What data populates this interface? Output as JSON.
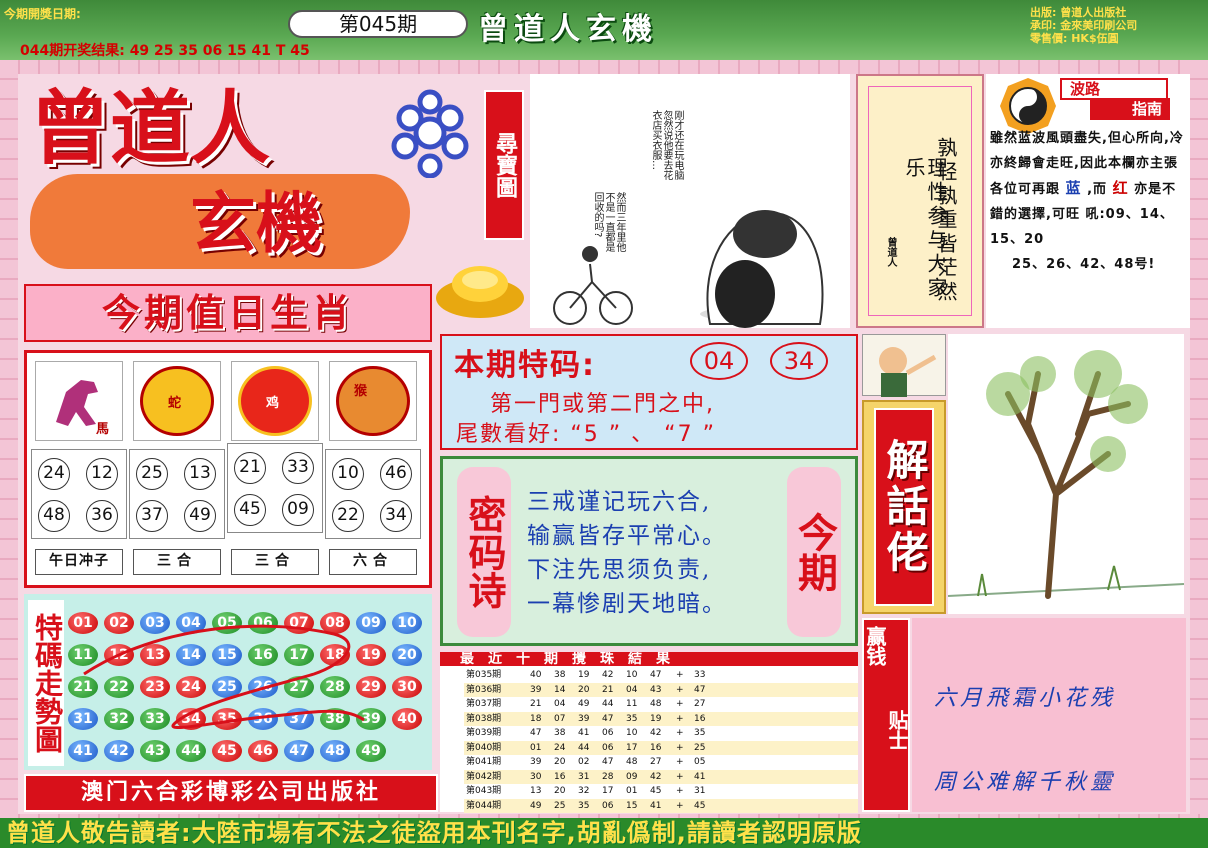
{
  "header": {
    "pub_date_label": "今期開獎日期:",
    "issue": "第045期",
    "prev_result": "044期开奖结果: 49 25 35 06 15 41 T 45",
    "brand": "曾道人玄機",
    "publisher_info": [
      "出版: 曾道人出版社",
      "承印: 金來美印刷公司",
      "零售價: HK$伍圓"
    ]
  },
  "border_pattern_text": "曾道人玄機",
  "logo": {
    "line1": "曾道人",
    "line2": "玄機",
    "tag": "尋寶圖"
  },
  "zodiac": {
    "title": "今期值日生肖",
    "columns": [
      {
        "animal": "馬",
        "numbers": [
          "24",
          "12",
          "48",
          "36"
        ],
        "footer": "午日冲子"
      },
      {
        "animal": "蛇",
        "numbers": [
          "25",
          "13",
          "37",
          "49"
        ],
        "footer": "三合"
      },
      {
        "animal": "鸡",
        "numbers": [
          "21",
          "33",
          "45",
          "09"
        ],
        "footer": "三合"
      },
      {
        "animal": "猴",
        "numbers": [
          "10",
          "46",
          "22",
          "34"
        ],
        "footer": "六合"
      }
    ]
  },
  "cartoon": {
    "bubble1": "刚才还在玩电脑忽然说他要去花衣店买衣服…",
    "bubble2": "然而三年里他不是一直都是回收的吗?"
  },
  "poem": {
    "col1": "孰轻孰重皆茫然",
    "col2": "理性参与大家乐",
    "seal": "曾道人"
  },
  "wave_guide": {
    "tag1": "波路",
    "tag2": "指南",
    "text_a": "雖然蓝波風頭盡失,但心所向,冷亦終歸會走旺,因此本欄亦主張各位可再跟",
    "blue_word": "蓝",
    "text_b": ",而",
    "red_word": "红",
    "text_c": "亦是不錯的選擇,可旺",
    "text_d": "吼:09、14、15、20",
    "text_e": "25、26、42、48号!"
  },
  "special_code": {
    "title": "本期特码:",
    "numbers": [
      "04",
      "34"
    ],
    "line1": "第一門或第二門之中,",
    "line2": "尾數看好: “5 ” 、 “7 ”"
  },
  "password_poem": {
    "label": "密码诗",
    "today": "今期",
    "lines": [
      "三戒谨记玩六合,",
      "输赢皆存平常心。",
      "下注先思须负责,",
      "一幕惨剧天地暗。"
    ]
  },
  "jiehua": {
    "label": "解話佬"
  },
  "win_tip": {
    "label_a": "赢钱",
    "label_b": "贴士",
    "line1": "六月飛霜小花残",
    "line2": "周公难解千秋靈"
  },
  "trend": {
    "label": "特碼走勢圖",
    "balls": [
      {
        "n": "01",
        "c": "red"
      },
      {
        "n": "02",
        "c": "red"
      },
      {
        "n": "03",
        "c": "blue"
      },
      {
        "n": "04",
        "c": "blue"
      },
      {
        "n": "05",
        "c": "green"
      },
      {
        "n": "06",
        "c": "green"
      },
      {
        "n": "07",
        "c": "red"
      },
      {
        "n": "08",
        "c": "red"
      },
      {
        "n": "09",
        "c": "blue"
      },
      {
        "n": "10",
        "c": "blue"
      },
      {
        "n": "11",
        "c": "green"
      },
      {
        "n": "12",
        "c": "red"
      },
      {
        "n": "13",
        "c": "red"
      },
      {
        "n": "14",
        "c": "blue"
      },
      {
        "n": "15",
        "c": "blue"
      },
      {
        "n": "16",
        "c": "green"
      },
      {
        "n": "17",
        "c": "green"
      },
      {
        "n": "18",
        "c": "red"
      },
      {
        "n": "19",
        "c": "red"
      },
      {
        "n": "20",
        "c": "blue"
      },
      {
        "n": "21",
        "c": "green"
      },
      {
        "n": "22",
        "c": "green"
      },
      {
        "n": "23",
        "c": "red"
      },
      {
        "n": "24",
        "c": "red"
      },
      {
        "n": "25",
        "c": "blue"
      },
      {
        "n": "26",
        "c": "blue"
      },
      {
        "n": "27",
        "c": "green"
      },
      {
        "n": "28",
        "c": "green"
      },
      {
        "n": "29",
        "c": "red"
      },
      {
        "n": "30",
        "c": "red"
      },
      {
        "n": "31",
        "c": "blue"
      },
      {
        "n": "32",
        "c": "green"
      },
      {
        "n": "33",
        "c": "green"
      },
      {
        "n": "34",
        "c": "red"
      },
      {
        "n": "35",
        "c": "red"
      },
      {
        "n": "36",
        "c": "blue"
      },
      {
        "n": "37",
        "c": "blue"
      },
      {
        "n": "38",
        "c": "green"
      },
      {
        "n": "39",
        "c": "green"
      },
      {
        "n": "40",
        "c": "red"
      },
      {
        "n": "41",
        "c": "blue"
      },
      {
        "n": "42",
        "c": "blue"
      },
      {
        "n": "43",
        "c": "green"
      },
      {
        "n": "44",
        "c": "green"
      },
      {
        "n": "45",
        "c": "red"
      },
      {
        "n": "46",
        "c": "red"
      },
      {
        "n": "47",
        "c": "blue"
      },
      {
        "n": "48",
        "c": "blue"
      },
      {
        "n": "49",
        "c": "green"
      }
    ]
  },
  "macau_bar": "澳门六合彩博彩公司出版社",
  "results": {
    "title": "最近十期攪珠結果",
    "rows": [
      {
        "issue": "第035期",
        "nums": [
          "40",
          "38",
          "19",
          "42",
          "10",
          "47"
        ],
        "special": "33"
      },
      {
        "issue": "第036期",
        "nums": [
          "39",
          "14",
          "20",
          "21",
          "04",
          "43"
        ],
        "special": "47"
      },
      {
        "issue": "第037期",
        "nums": [
          "21",
          "04",
          "49",
          "44",
          "11",
          "48"
        ],
        "special": "27"
      },
      {
        "issue": "第038期",
        "nums": [
          "18",
          "07",
          "39",
          "47",
          "35",
          "19"
        ],
        "special": "16"
      },
      {
        "issue": "第039期",
        "nums": [
          "47",
          "38",
          "41",
          "06",
          "10",
          "42"
        ],
        "special": "35"
      },
      {
        "issue": "第040期",
        "nums": [
          "01",
          "24",
          "44",
          "06",
          "17",
          "16"
        ],
        "special": "25"
      },
      {
        "issue": "第041期",
        "nums": [
          "39",
          "20",
          "02",
          "47",
          "48",
          "27"
        ],
        "special": "05"
      },
      {
        "issue": "第042期",
        "nums": [
          "30",
          "16",
          "31",
          "28",
          "09",
          "42"
        ],
        "special": "41"
      },
      {
        "issue": "第043期",
        "nums": [
          "13",
          "20",
          "32",
          "17",
          "01",
          "45"
        ],
        "special": "31"
      },
      {
        "issue": "第044期",
        "nums": [
          "49",
          "25",
          "35",
          "06",
          "15",
          "41"
        ],
        "special": "45"
      }
    ]
  },
  "footer": "曾道人敬告讀者:大陸市場有不法之徒盜用本刊名字,胡亂僞制,請讀者認明原版"
}
